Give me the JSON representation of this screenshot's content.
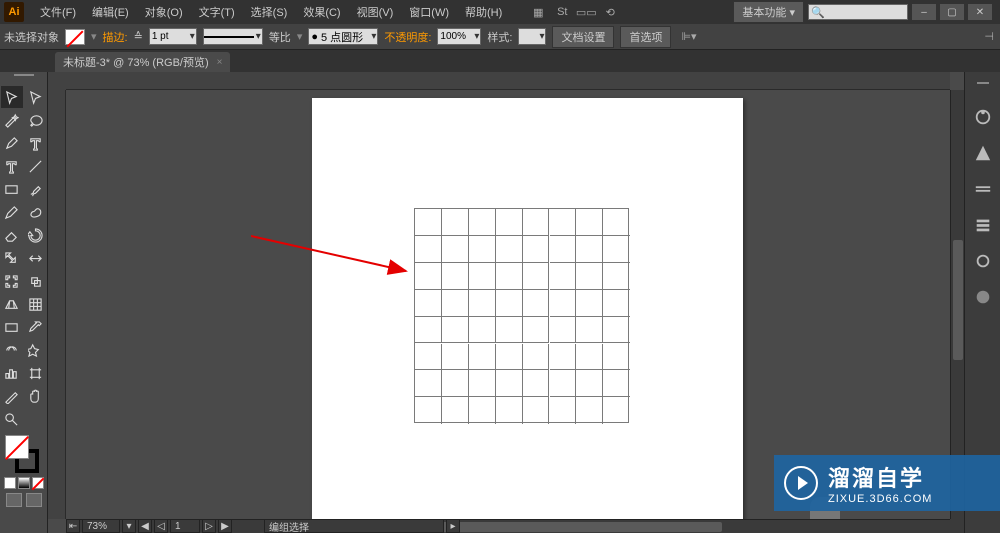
{
  "menubar": {
    "items": [
      "文件(F)",
      "编辑(E)",
      "对象(O)",
      "文字(T)",
      "选择(S)",
      "效果(C)",
      "视图(V)",
      "窗口(W)",
      "帮助(H)"
    ],
    "workspace_label": "基本功能"
  },
  "options": {
    "no_selection": "未选择对象",
    "stroke_label": "描边:",
    "stroke_value": "1 pt",
    "uniform": "等比",
    "brush": "5 点圆形",
    "opacity_label": "不透明度:",
    "opacity_value": "100%",
    "style_label": "样式:",
    "doc_setup": "文档设置",
    "prefs": "首选项"
  },
  "tab": {
    "title": "未标题-3* @ 73% (RGB/预览)"
  },
  "status": {
    "zoom": "73%",
    "page": "1",
    "mode": "编组选择"
  },
  "watermark": {
    "title": "溜溜自学",
    "url": "ZIXUE.3D66.COM"
  },
  "tools": [
    [
      "selection",
      "direct-selection"
    ],
    [
      "magic-wand",
      "lasso"
    ],
    [
      "pen",
      "type"
    ],
    [
      "type",
      "line"
    ],
    [
      "rectangle",
      "paintbrush"
    ],
    [
      "pencil",
      "blob-brush"
    ],
    [
      "eraser",
      "rotate"
    ],
    [
      "scale",
      "width"
    ],
    [
      "free-transform",
      "shape-builder"
    ],
    [
      "perspective",
      "mesh"
    ],
    [
      "gradient",
      "eyedropper"
    ],
    [
      "blend",
      "symbol"
    ],
    [
      "column-graph",
      "artboard"
    ],
    [
      "slice",
      "hand"
    ],
    [
      "zoom",
      "blank"
    ]
  ],
  "dock_icons": [
    "color",
    "swatches",
    "stroke",
    "brushes",
    "symbols",
    "layers"
  ]
}
